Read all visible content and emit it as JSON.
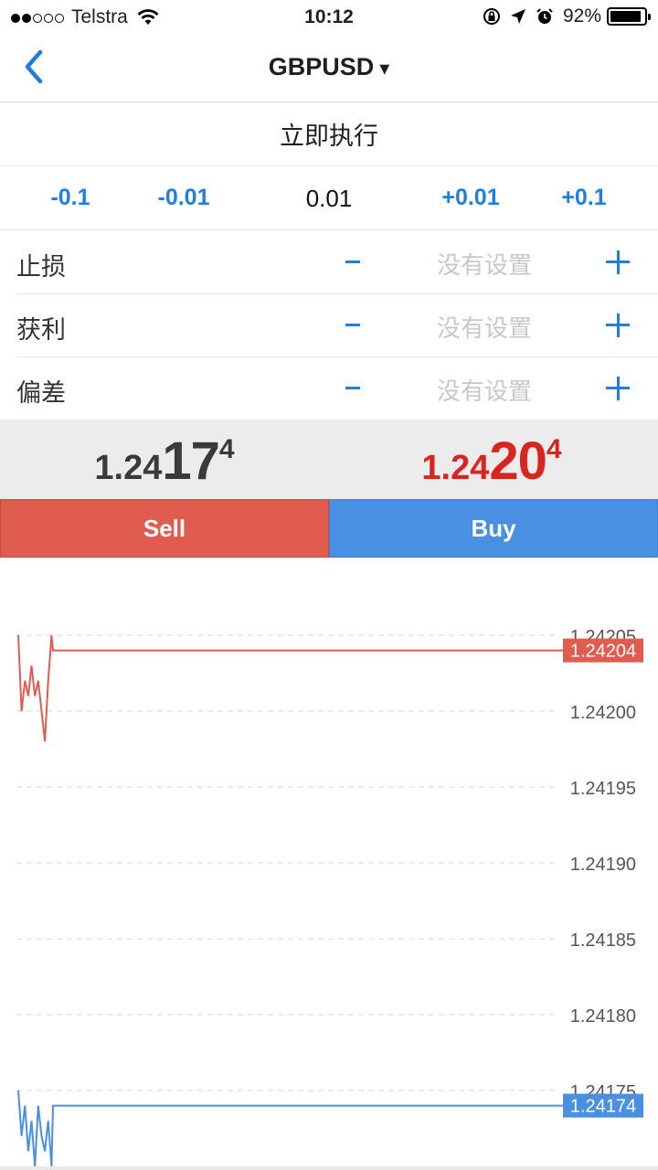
{
  "status_bar": {
    "carrier": "Telstra",
    "time": "10:12",
    "battery": "92%",
    "battery_level": 0.92,
    "signal_bars_filled": 2,
    "signal_bars_total": 5
  },
  "nav": {
    "title": "GBPUSD",
    "caret": "▾"
  },
  "execution": {
    "label": "立即执行"
  },
  "volume": {
    "dec_large": "-0.1",
    "dec_small": "-0.01",
    "value": "0.01",
    "inc_small": "+0.01",
    "inc_large": "+0.1"
  },
  "params": [
    {
      "label": "止损",
      "value": "没有设置"
    },
    {
      "label": "获利",
      "value": "没有设置"
    },
    {
      "label": "偏差",
      "value": "没有设置"
    }
  ],
  "prices": {
    "bid": {
      "base": "1.24",
      "big": "17",
      "sup": "4"
    },
    "ask": {
      "base": "1.24",
      "big": "20",
      "sup": "4"
    }
  },
  "buttons": {
    "sell": "Sell",
    "buy": "Buy"
  },
  "colors": {
    "accent": "#1e7fe0",
    "ask_red": "#d9251d",
    "sell_bg": "#e05c4f",
    "buy_bg": "#4a90e2",
    "ask_line": "#e05c4f",
    "bid_line": "#4a90e2"
  },
  "chart_data": {
    "type": "line",
    "ylim": [
      1.24172,
      1.24207
    ],
    "y_ticks": [
      "1.24205",
      "1.24200",
      "1.24195",
      "1.24190",
      "1.24185",
      "1.24180",
      "1.24175"
    ],
    "grid": true,
    "series": [
      {
        "role": "ask",
        "color": "#e05c4f",
        "last_label": "1.24204",
        "values": [
          1.24205,
          1.242,
          1.24202,
          1.24201,
          1.24203,
          1.24201,
          1.24202,
          1.242,
          1.24198,
          1.24202,
          1.24205,
          1.24204,
          1.24204
        ]
      },
      {
        "role": "bid",
        "color": "#4a90e2",
        "last_label": "1.24174",
        "values": [
          1.24175,
          1.24172,
          1.24174,
          1.24171,
          1.24173,
          1.2417,
          1.24174,
          1.24172,
          1.24171,
          1.24173,
          1.2417,
          1.24174,
          1.24174
        ]
      }
    ]
  }
}
